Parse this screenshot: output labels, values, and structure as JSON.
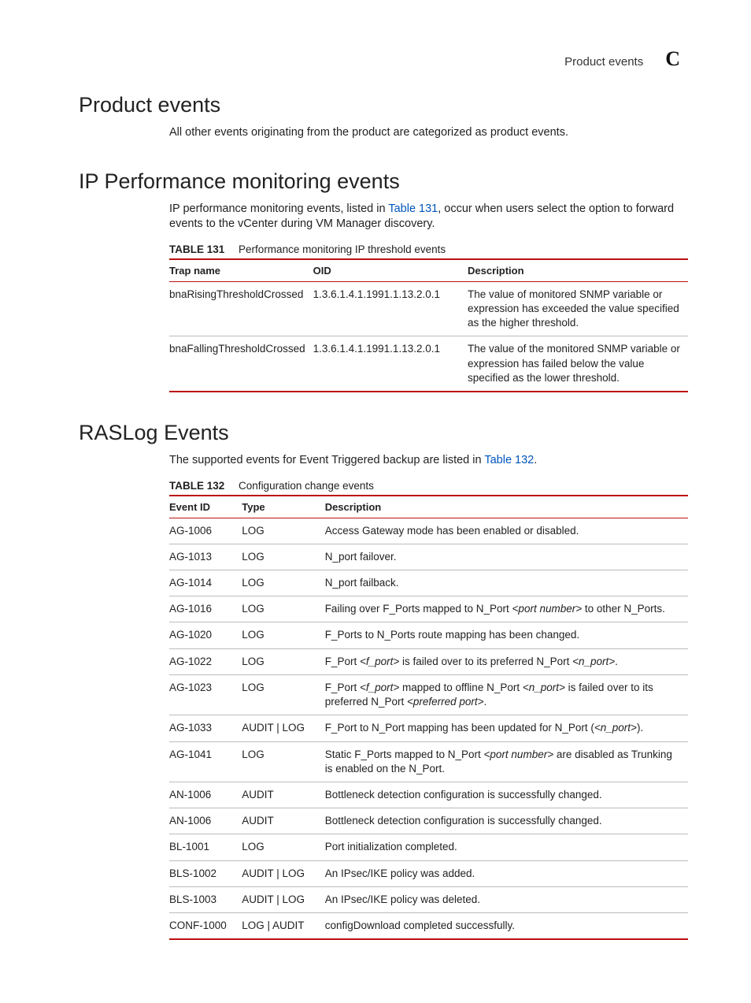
{
  "header": {
    "title": "Product events",
    "appendix": "C"
  },
  "section1": {
    "heading": "Product events",
    "body": "All other events originating from the product are categorized as product events."
  },
  "section2": {
    "heading": "IP Performance monitoring events",
    "body_pre": "IP performance monitoring events, listed in ",
    "body_link": "Table 131",
    "body_post": ", occur when users select the option to forward events to the vCenter during VM Manager discovery.",
    "table": {
      "num": "TABLE 131",
      "title": "Performance monitoring IP threshold events",
      "cols": [
        "Trap name",
        "OID",
        "Description"
      ],
      "rows": [
        {
          "trap": "bnaRisingThresholdCrossed",
          "oid": "1.3.6.1.4.1.1991.1.13.2.0.1",
          "desc": "The value of monitored SNMP variable or expression has exceeded the value specified as the higher threshold."
        },
        {
          "trap": "bnaFallingThresholdCrossed",
          "oid": "1.3.6.1.4.1.1991.1.13.2.0.1",
          "desc": "The value of the monitored SNMP variable or expression has failed below the value specified as the lower threshold."
        }
      ]
    }
  },
  "section3": {
    "heading": "RASLog Events",
    "body_pre": "The supported events for Event Triggered backup are listed in ",
    "body_link": "Table 132",
    "body_post": ".",
    "table": {
      "num": "TABLE 132",
      "title": "Configuration change events",
      "cols": [
        "Event ID",
        "Type",
        "Description"
      ],
      "rows": [
        {
          "id": "AG-1006",
          "type": "LOG",
          "desc": "Access Gateway mode has been enabled or disabled."
        },
        {
          "id": "AG-1013",
          "type": "LOG",
          "desc": "N_port failover."
        },
        {
          "id": "AG-1014",
          "type": "LOG",
          "desc": "N_port failback."
        },
        {
          "id": "AG-1016",
          "type": "LOG",
          "desc": "Failing over F_Ports mapped to N_Port <port number> to other N_Ports."
        },
        {
          "id": "AG-1020",
          "type": "LOG",
          "desc": "F_Ports to N_Ports route mapping has been changed."
        },
        {
          "id": "AG-1022",
          "type": "LOG",
          "desc": "F_Port <f_port> is failed over to its preferred N_Port <n_port>."
        },
        {
          "id": "AG-1023",
          "type": "LOG",
          "desc": "F_Port <f_port> mapped to offline N_Port <n_port> is failed over to its preferred N_Port <preferred port>."
        },
        {
          "id": "AG-1033",
          "type": "AUDIT | LOG",
          "desc": "F_Port to N_Port mapping has been updated for N_Port (<n_port>)."
        },
        {
          "id": "AG-1041",
          "type": "LOG",
          "desc": "Static F_Ports mapped to N_Port <port number> are disabled as Trunking is enabled on the N_Port."
        },
        {
          "id": "AN-1006",
          "type": "AUDIT",
          "desc": "Bottleneck detection configuration is successfully changed."
        },
        {
          "id": "AN-1006",
          "type": "AUDIT",
          "desc": "Bottleneck detection configuration is successfully changed."
        },
        {
          "id": "BL-1001",
          "type": "LOG",
          "desc": "Port initialization completed."
        },
        {
          "id": "BLS-1002",
          "type": "AUDIT | LOG",
          "desc": "An IPsec/IKE policy was added."
        },
        {
          "id": "BLS-1003",
          "type": "AUDIT | LOG",
          "desc": "An IPsec/IKE policy was deleted."
        },
        {
          "id": "CONF-1000",
          "type": "LOG | AUDIT",
          "desc": "configDownload completed successfully."
        }
      ]
    }
  }
}
